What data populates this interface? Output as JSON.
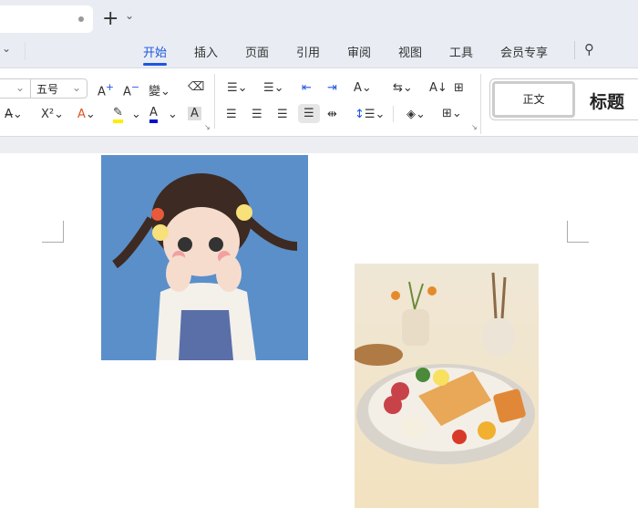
{
  "titlebar": {
    "new_tab": "+",
    "tab_dropdown": "⌄"
  },
  "ribbon_tabs": [
    "开始",
    "插入",
    "页面",
    "引用",
    "审阅",
    "视图",
    "工具",
    "会员专享"
  ],
  "font_size": "五号",
  "styles": {
    "normal": "正文",
    "heading": "标题"
  },
  "colors": {
    "accent": "#1f55e0",
    "highlight": "#ffee00",
    "font_color": "#0010d0"
  }
}
